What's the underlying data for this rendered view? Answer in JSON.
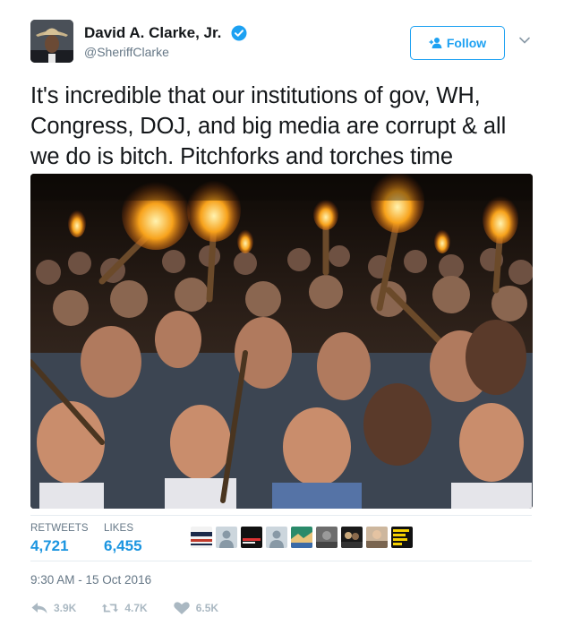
{
  "author": {
    "display_name": "David A. Clarke, Jr.",
    "handle": "@SheriffClarke",
    "verified": true
  },
  "follow_button": {
    "label": "Follow"
  },
  "tweet": {
    "text": "It's incredible that our institutions of gov, WH, Congress, DOJ, and big media are corrupt & all we do is bitch. Pitchforks and torches time",
    "timestamp": "9:30 AM - 15 Oct 2016"
  },
  "stats": {
    "retweets_label": "RETWEETS",
    "retweets_value": "4,721",
    "likes_label": "LIKES",
    "likes_value": "6,455"
  },
  "liker_avatars": [
    {
      "name": "liker-avatar-trump-banner",
      "text": "TRUMP"
    },
    {
      "name": "liker-avatar-default"
    },
    {
      "name": "liker-avatar-dark-banner"
    },
    {
      "name": "liker-avatar-default"
    },
    {
      "name": "liker-avatar-landscape"
    },
    {
      "name": "liker-avatar-photo"
    },
    {
      "name": "liker-avatar-photo-dark"
    },
    {
      "name": "liker-avatar-person"
    },
    {
      "name": "liker-avatar-yellow-banner"
    }
  ],
  "actions": {
    "reply_count": "3.9K",
    "retweet_count": "4.7K",
    "like_count": "6.5K"
  },
  "colors": {
    "accent": "#1da1f2",
    "link": "#1b95e0",
    "muted": "#657786",
    "action_gray": "#aab8c2"
  }
}
